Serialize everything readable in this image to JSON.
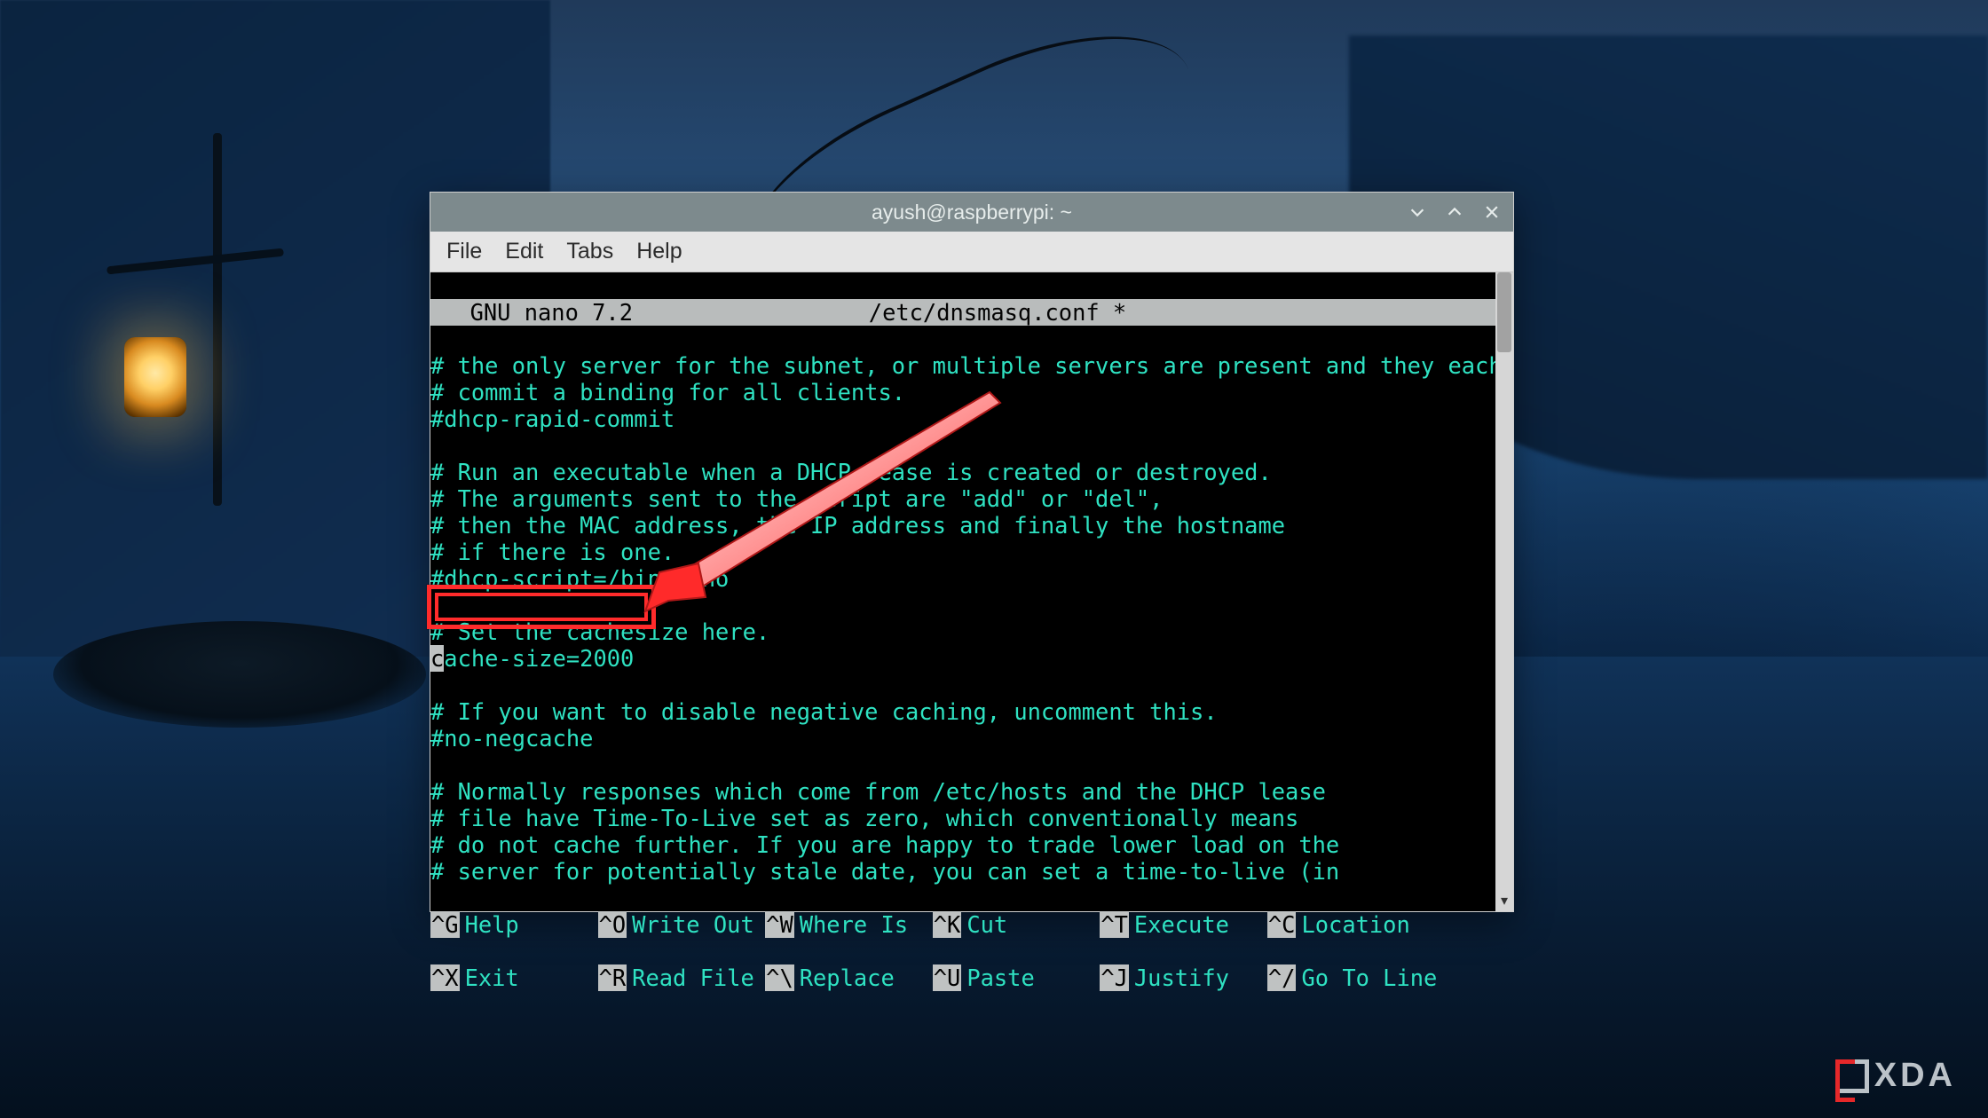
{
  "window": {
    "title": "ayush@raspberrypi: ~"
  },
  "menubar": {
    "file": "File",
    "edit": "Edit",
    "tabs": "Tabs",
    "help": "Help"
  },
  "nano": {
    "app": "  GNU nano 7.2",
    "file": "/etc/dnsmasq.conf *"
  },
  "lines": {
    "l1": "# the only server for the subnet, or multiple servers are present and they each",
    "l2": "# commit a binding for all clients.",
    "l3": "#dhcp-rapid-commit",
    "l4": "",
    "l5": "# Run an executable when a DHCP lease is created or destroyed.",
    "l6": "# The arguments sent to the script are \"add\" or \"del\",",
    "l7": "# then the MAC address, the IP address and finally the hostname",
    "l8": "# if there is one.",
    "l9": "#dhcp-script=/bin/echo",
    "l10": "",
    "l11": "# Set the cachesize here.",
    "l12a": "c",
    "l12b": "ache-size=2000",
    "l13": "",
    "l14": "# If you want to disable negative caching, uncomment this.",
    "l15": "#no-negcache",
    "l16": "",
    "l17": "# Normally responses which come from /etc/hosts and the DHCP lease",
    "l18": "# file have Time-To-Live set as zero, which conventionally means",
    "l19": "# do not cache further. If you are happy to trade lower load on the",
    "l20": "# server for potentially stale date, you can set a time-to-live (in"
  },
  "help": {
    "g": "^G",
    "g_l": "Help",
    "o": "^O",
    "o_l": "Write Out",
    "w": "^W",
    "w_l": "Where Is",
    "k": "^K",
    "k_l": "Cut",
    "t": "^T",
    "t_l": "Execute",
    "c": "^C",
    "c_l": "Location",
    "x": "^X",
    "x_l": "Exit",
    "r": "^R",
    "r_l": "Read File",
    "bs": "^\\",
    "bs_l": "Replace",
    "u": "^U",
    "u_l": "Paste",
    "j": "^J",
    "j_l": "Justify",
    "sl": "^/",
    "sl_l": "Go To Line"
  },
  "watermark": "XDA"
}
